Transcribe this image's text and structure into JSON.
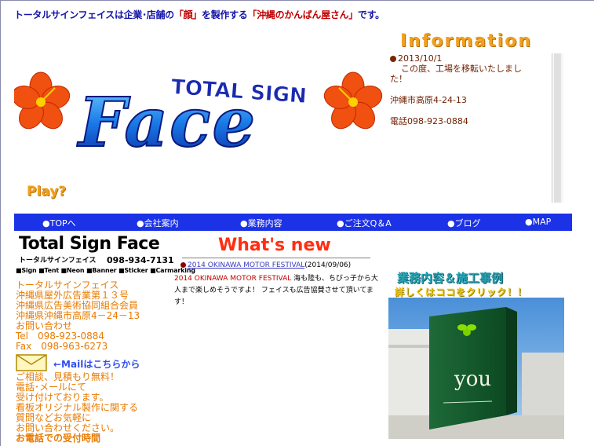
{
  "header": {
    "tagline_pre": "トータルサインフェイスは企業･店舗の",
    "tagline_hl": "「顔」",
    "tagline_mid": "を製作する",
    "tagline_hl2": "「沖縄のかんばん屋さん」",
    "tagline_post": "です。"
  },
  "banner": {
    "logo_small": "TOTAL SIGN",
    "logo_big": "Face",
    "play_label": "Play?"
  },
  "information": {
    "title": "Information",
    "date": "2013/10/1",
    "line1": "この度、工場を移転いたしまし",
    "line2": "た！",
    "address": "沖縄市高原4-24-13",
    "phone": "電話098-923-0884"
  },
  "nav": {
    "items": [
      {
        "label": "●TOPへ"
      },
      {
        "label": "●会社案内"
      },
      {
        "label": "●業務内容"
      },
      {
        "label": "●ご注文Q＆A"
      },
      {
        "label": "●ブログ"
      },
      {
        "label": "●MAP"
      }
    ]
  },
  "company_logo": {
    "main": "Total Sign Face",
    "sub": "トータルサインフェイス",
    "phone": "098-934-7131",
    "tags": "■Sign ■Tent ■Neon ■Banner ■Sticker ■Carmarking"
  },
  "company": {
    "lines": [
      "トータルサインフェイス",
      "沖縄県屋外広告業第１３号",
      "沖縄県広告美術協同組合会員",
      "沖縄県沖縄市高原4－24－13",
      "お問い合わせ",
      "Tel　098-923-0884",
      "Fax　098-963-6273"
    ],
    "mail_link": "←Mailはこちらから",
    "lines2": [
      "ご相談、見積もり無料！",
      "電話･メールにて",
      "受け付けております。",
      "看板オリジナル製作に関する",
      "質問などお気軽に",
      "お問い合わせください。"
    ],
    "hours_label": "お電話での受付時間"
  },
  "whats_new": {
    "title": "What's new",
    "item_link": "2014 OKINAWA MOTOR FESTIVAL",
    "item_date": "(2014/09/06)",
    "body_accent": "2014 OKINAWA MOTOR FESTIVAL",
    "body": " 海も陸も、ちびっ子から大人まで楽しめそうですよ！ フェイスも広告協賛させて頂いてます！"
  },
  "works": {
    "title": "業務内容＆施工事例",
    "subtitle": "詳しくはココをクリック！！",
    "photo_sign": "you"
  },
  "colors": {
    "nav_bg": "#1c32e6",
    "accent_orange": "#e87a00",
    "info_brown": "#702000",
    "whatsnew_red": "#ff2e10"
  }
}
